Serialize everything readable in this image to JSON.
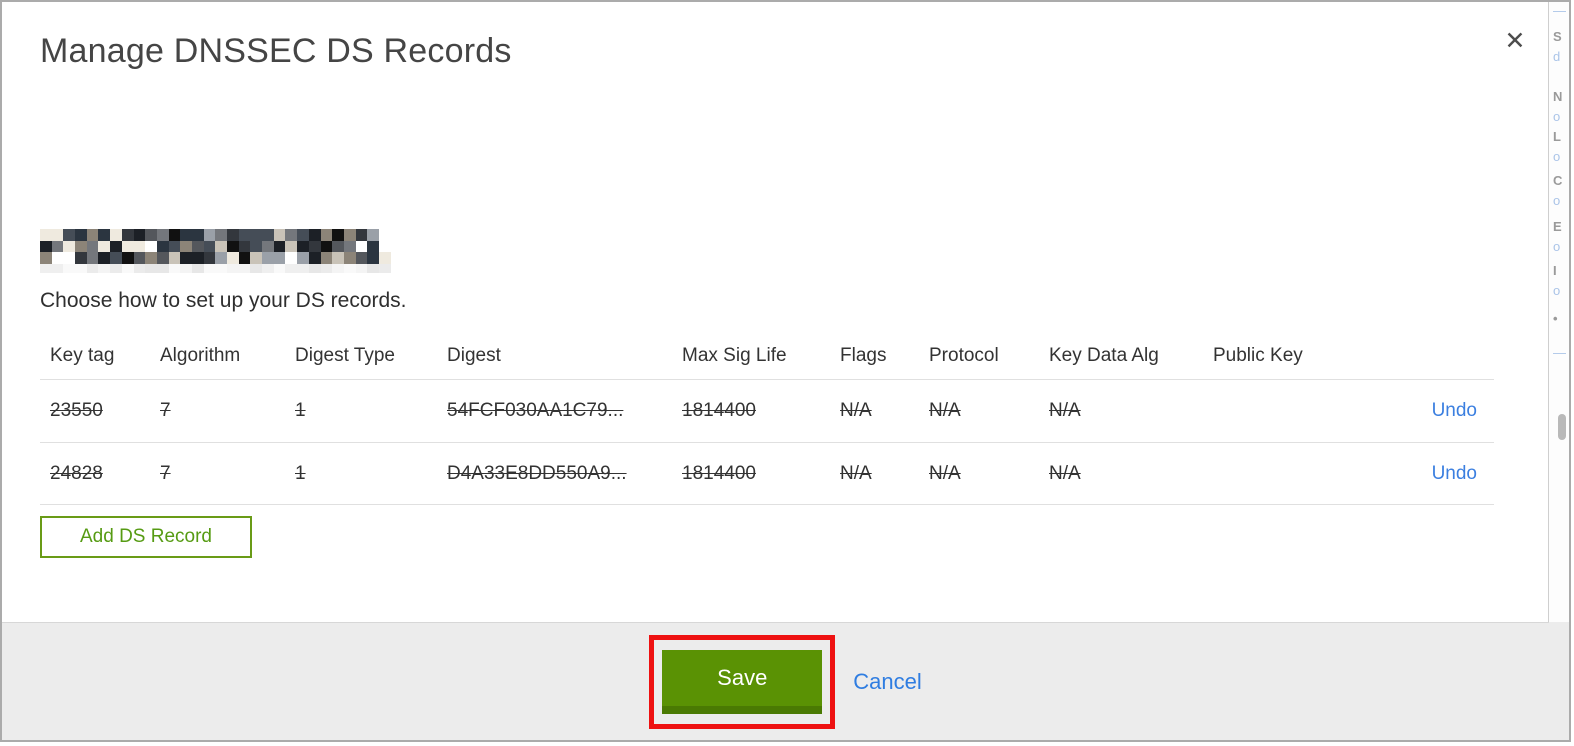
{
  "modal": {
    "title": "Manage DNSSEC DS Records",
    "close_label": "✕",
    "instruction": "Choose how to set up your DS records.",
    "domain": {
      "redacted": true
    },
    "table": {
      "headers": [
        "Key tag",
        "Algorithm",
        "Digest Type",
        "Digest",
        "Max Sig Life",
        "Flags",
        "Protocol",
        "Key Data Alg",
        "Public Key"
      ],
      "rows": [
        {
          "key_tag": "23550",
          "algorithm": "7",
          "digest_type": "1",
          "digest": "54FCF030AA1C79...",
          "max_sig_life": "1814400",
          "flags": "N/A",
          "protocol": "N/A",
          "key_data_alg": "N/A",
          "public_key": "",
          "undo_label": "Undo",
          "state": "marked-for-deletion"
        },
        {
          "key_tag": "24828",
          "algorithm": "7",
          "digest_type": "1",
          "digest": "D4A33E8DD550A9...",
          "max_sig_life": "1814400",
          "flags": "N/A",
          "protocol": "N/A",
          "key_data_alg": "N/A",
          "public_key": "",
          "undo_label": "Undo",
          "state": "marked-for-deletion"
        }
      ]
    },
    "add_record_label": "Add DS Record",
    "footer": {
      "save_label": "Save",
      "cancel_label": "Cancel"
    }
  },
  "colors": {
    "save_green": "#5a9204",
    "save_green_dark": "#4a7a03",
    "outline_green": "#699b17",
    "link_blue": "#2f7de1",
    "undo_blue": "#3b7fe0",
    "annotation_red": "#ee1111",
    "row_stripe": "#f6f6f6",
    "footer_bg": "#ececec",
    "title_gray": "#454545"
  },
  "redacted_domain": {
    "cols": 30,
    "rows": 3,
    "palette": [
      "#1c2026",
      "#33373d",
      "#54575c",
      "#74777c",
      "#9aa0a8",
      "#c9c3b8",
      "#efeadf",
      "#ffffff",
      "#2b3540",
      "#8c8478",
      "#454d57",
      "#111111"
    ],
    "faint_palette": [
      "#f4f4f4",
      "#ebebeb",
      "#f9f9f9",
      "#efefef",
      "#e7e7e7"
    ]
  }
}
